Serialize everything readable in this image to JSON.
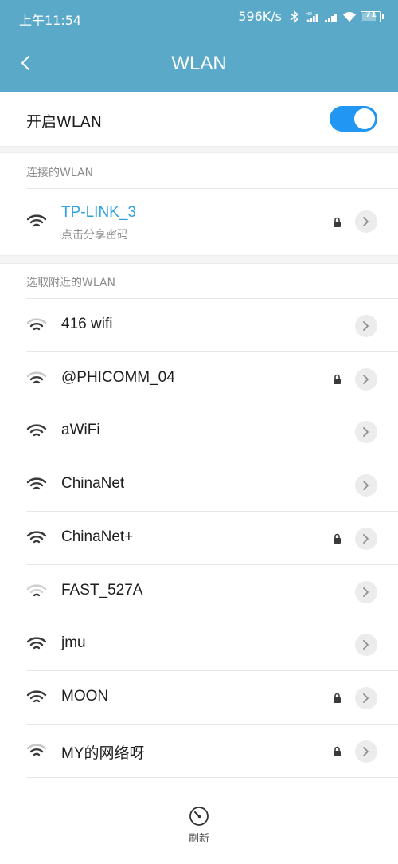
{
  "status_bar": {
    "time": "上午11:54",
    "speed": "596K/s",
    "battery_level": "71",
    "icons": [
      "bluetooth-icon",
      "hd-signal-icon",
      "signal-icon",
      "wifi-icon",
      "battery-icon"
    ]
  },
  "header": {
    "title": "WLAN",
    "back_icon": "chevron-left-icon",
    "background_color": "#5aa9c8"
  },
  "toggle": {
    "label": "开启WLAN",
    "enabled": true,
    "accent_color": "#2196f3"
  },
  "connected_section": {
    "title": "连接的WLAN",
    "network": {
      "name": "TP-LINK_3",
      "subtitle": "点击分享密码",
      "secured": true,
      "signal": "strong"
    }
  },
  "nearby_section": {
    "title": "选取附近的WLAN",
    "networks": [
      {
        "name": "416 wifi",
        "secured": false,
        "signal": "weak"
      },
      {
        "name": "@PHICOMM_04",
        "secured": true,
        "signal": "weak"
      },
      {
        "name": "aWiFi",
        "secured": false,
        "signal": "strong"
      },
      {
        "name": "ChinaNet",
        "secured": false,
        "signal": "strong"
      },
      {
        "name": "ChinaNet+",
        "secured": true,
        "signal": "strong"
      },
      {
        "name": "FAST_527A",
        "secured": false,
        "signal": "faint"
      },
      {
        "name": "jmu",
        "secured": false,
        "signal": "strong"
      },
      {
        "name": "MOON",
        "secured": true,
        "signal": "strong"
      },
      {
        "name": "MY的网络呀",
        "secured": true,
        "signal": "weak"
      }
    ]
  },
  "bottom": {
    "refresh_label": "刷新",
    "refresh_icon": "refresh-icon"
  }
}
